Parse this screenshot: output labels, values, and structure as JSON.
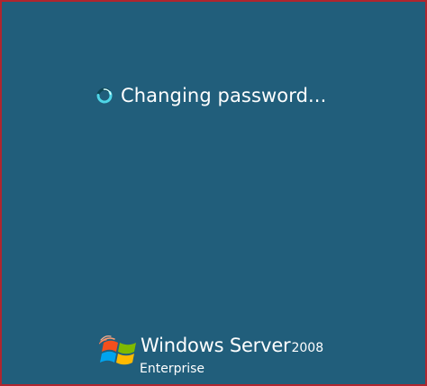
{
  "status": {
    "message": "Changing password..."
  },
  "branding": {
    "product": "Windows Server",
    "version": "2008",
    "edition": "Enterprise",
    "colors": {
      "background": "#215e7b",
      "frame": "#b0262f",
      "spinner": "#4fd6e8",
      "text": "#ffffff"
    },
    "logo_icon": "windows-flag-icon",
    "spinner_icon": "loading-spinner-icon"
  }
}
